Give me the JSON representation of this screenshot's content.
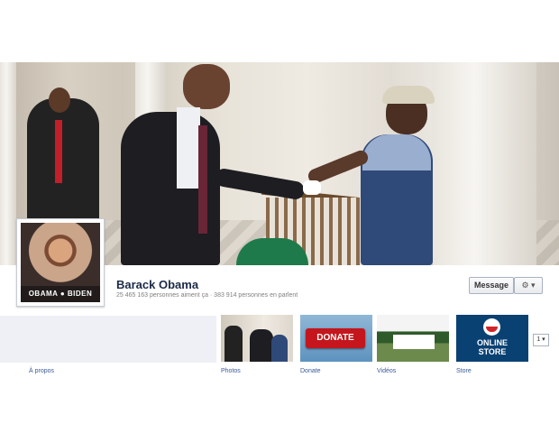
{
  "profile": {
    "name": "Barack Obama",
    "stats": "25 465 163 personnes aiment ça · 383 914 personnes en parlent",
    "picture_banner": "OBAMA ● BIDEN"
  },
  "actions": {
    "message_label": "Message",
    "settings_label": "⚙ ▾"
  },
  "tabs": [
    {
      "label": "À propos"
    },
    {
      "label": "Photos"
    },
    {
      "label": "Donate"
    },
    {
      "label": "Vidéos"
    },
    {
      "label": "Store"
    }
  ],
  "apps": {
    "donate_button": "DONATE",
    "store_text_line1": "ONLINE",
    "store_text_line2": "STORE",
    "more_label": "1 ▾"
  },
  "colors": {
    "link": "#3b5998",
    "name": "#1c2a47",
    "donate": "#c4161c",
    "store_bg": "#0a4173"
  }
}
